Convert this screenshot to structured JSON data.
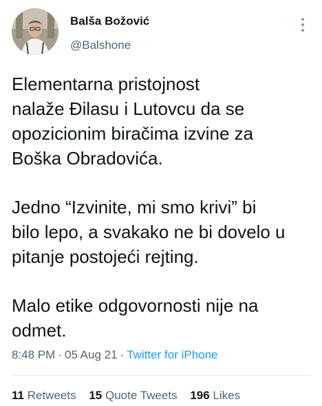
{
  "author": {
    "name": "Balša Božović",
    "handle": "@Balshone"
  },
  "tweet": {
    "paragraphs": [
      "Elementarna pristojnost\nnalaže Đilasu i Lutovcu da se\nopozicionim biračima izvine za\nBoška Obradovića.",
      "Jedno “Izvinite, mi smo krivi” bi\nbilo lepo, a svakako ne bi dovelo u\npitanje postojeći rejting.",
      "Malo etike odgovornosti nije na\nodmet."
    ],
    "time": "8:48 PM",
    "date": "05 Aug 21",
    "source": "Twitter for iPhone"
  },
  "stats": {
    "retweets": {
      "count": "11",
      "label": "Retweets"
    },
    "quotes": {
      "count": "15",
      "label": "Quote Tweets"
    },
    "likes": {
      "count": "196",
      "label": "Likes"
    }
  },
  "colors": {
    "text": "#0f1419",
    "secondary": "#536471",
    "link": "#1d9bf0",
    "divider": "#e6ecf0"
  },
  "icons": {
    "more": "more-vertical-icon"
  }
}
